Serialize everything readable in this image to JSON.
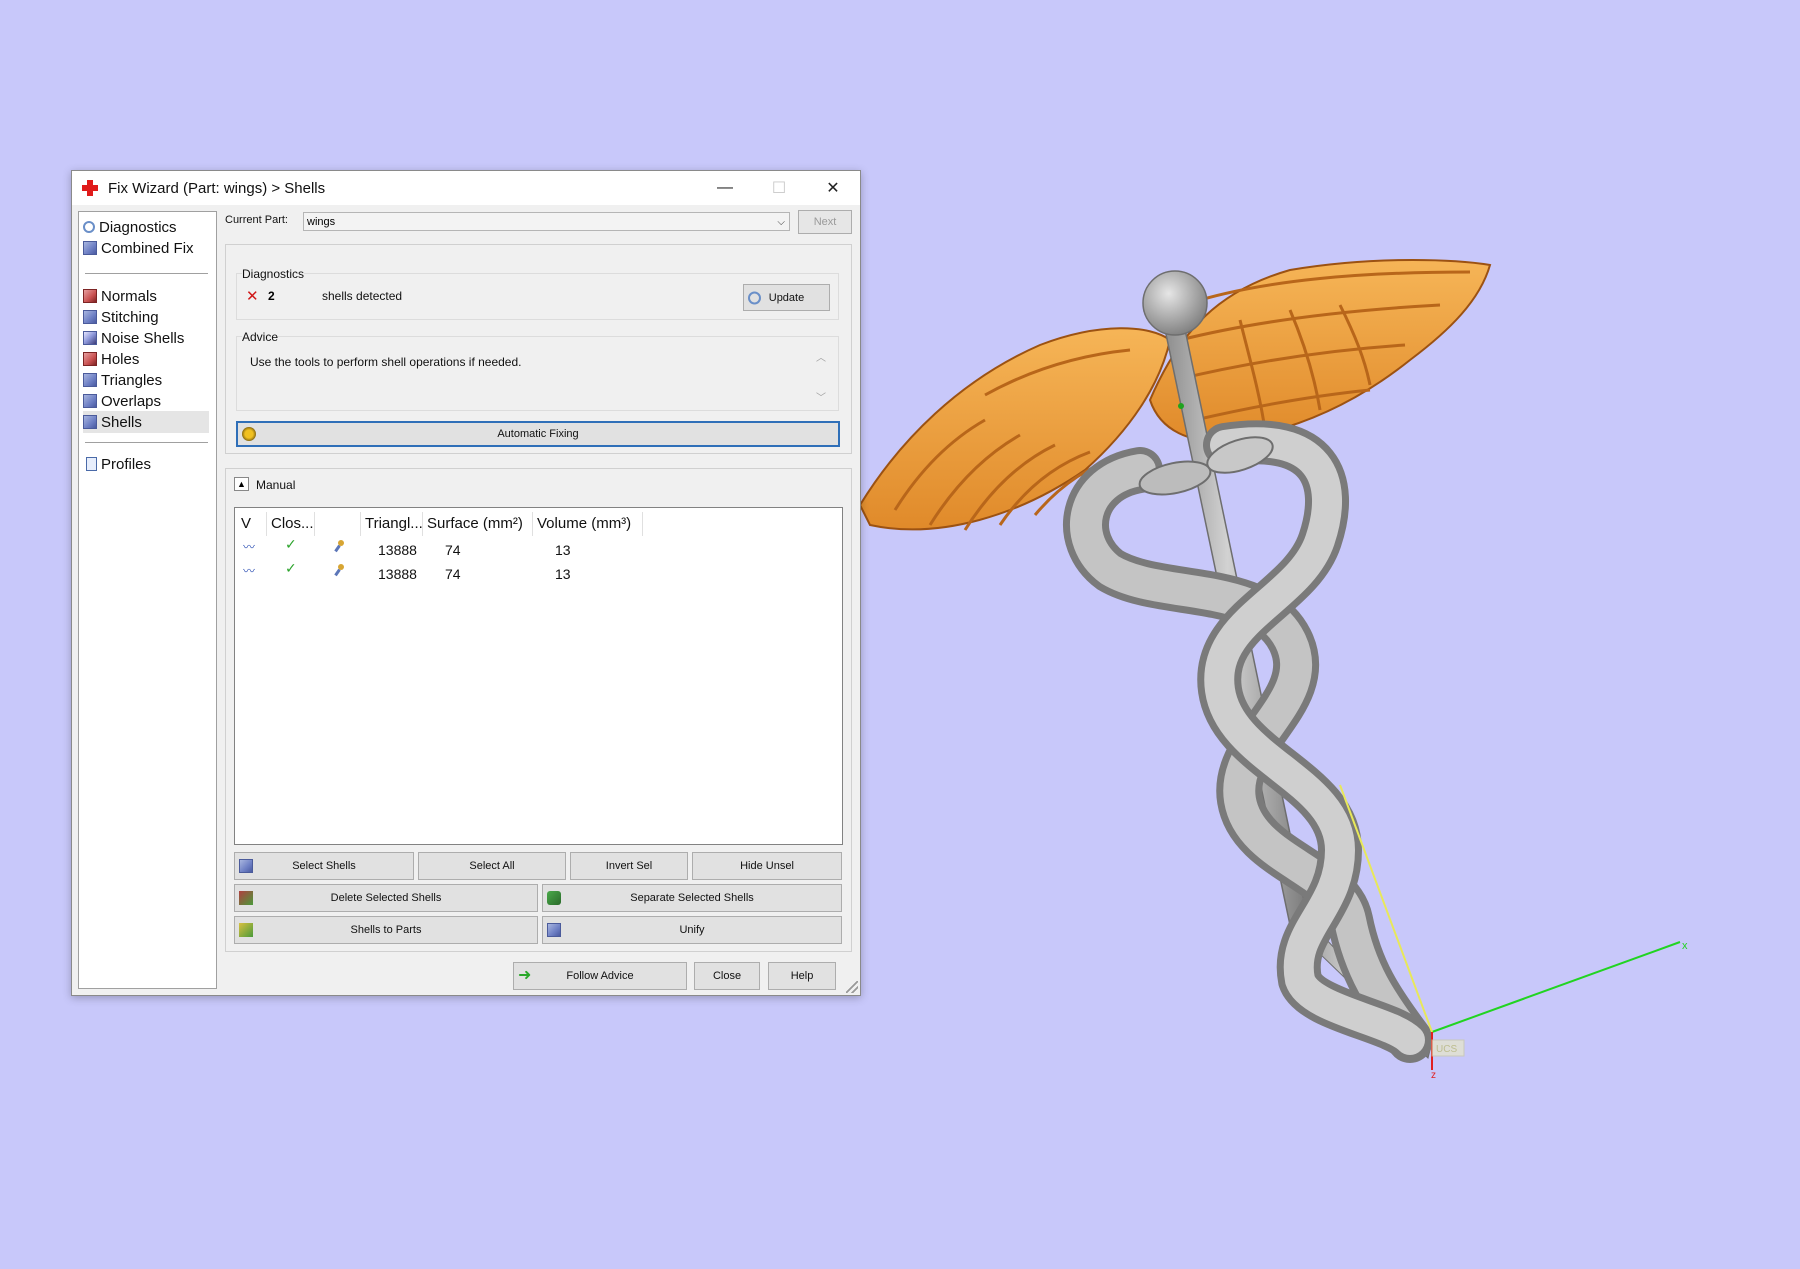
{
  "window": {
    "title": "Fix Wizard (Part: wings) > Shells",
    "controls": {
      "minimize": "—",
      "maximize": "☐",
      "close": "✕"
    }
  },
  "sidebar": {
    "items": [
      {
        "label": "Diagnostics",
        "icon": "magnifier-icon"
      },
      {
        "label": "Combined Fix",
        "icon": "cube-icon"
      },
      {
        "label": "Normals",
        "icon": "normals-icon"
      },
      {
        "label": "Stitching",
        "icon": "stitching-icon"
      },
      {
        "label": "Noise Shells",
        "icon": "noise-shells-icon"
      },
      {
        "label": "Holes",
        "icon": "holes-icon"
      },
      {
        "label": "Triangles",
        "icon": "triangles-icon"
      },
      {
        "label": "Overlaps",
        "icon": "overlaps-icon"
      },
      {
        "label": "Shells",
        "icon": "shells-icon",
        "selected": true
      },
      {
        "label": "Profiles",
        "icon": "profiles-icon"
      }
    ]
  },
  "topbar": {
    "current_part_label": "Current Part:",
    "current_part_value": "wings",
    "next_label": "Next"
  },
  "diagnostics": {
    "title": "Diagnostics",
    "count": "2",
    "message": "shells detected",
    "update_label": "Update"
  },
  "advice": {
    "title": "Advice",
    "text": "Use the tools to perform shell operations if needed.",
    "automatic_fixing_label": "Automatic Fixing"
  },
  "manual": {
    "title": "Manual",
    "columns": [
      "V",
      "Clos...",
      "",
      "Triangl...",
      "Surface (mm²)",
      "Volume (mm³)"
    ],
    "rows": [
      {
        "triangles": "13888",
        "surface": "74",
        "volume": "13"
      },
      {
        "triangles": "13888",
        "surface": "74",
        "volume": "13"
      }
    ],
    "buttons": {
      "select_shells": "Select Shells",
      "select_all": "Select All",
      "invert_sel": "Invert Sel",
      "hide_unsel": "Hide Unsel",
      "delete_selected": "Delete Selected Shells",
      "separate_selected": "Separate Selected Shells",
      "shells_to_parts": "Shells to Parts",
      "unify": "Unify"
    }
  },
  "footer": {
    "follow_advice": "Follow Advice",
    "close": "Close",
    "help": "Help"
  },
  "viewport": {
    "axis_x": "x",
    "axis_z": "z",
    "ucs_label": "UCS"
  },
  "colors": {
    "background": "#c8c8fa",
    "wing": "#f2a642",
    "wing_dark": "#b8661a",
    "metal": "#a8a8a8",
    "metal_dark": "#6e6e6e"
  }
}
